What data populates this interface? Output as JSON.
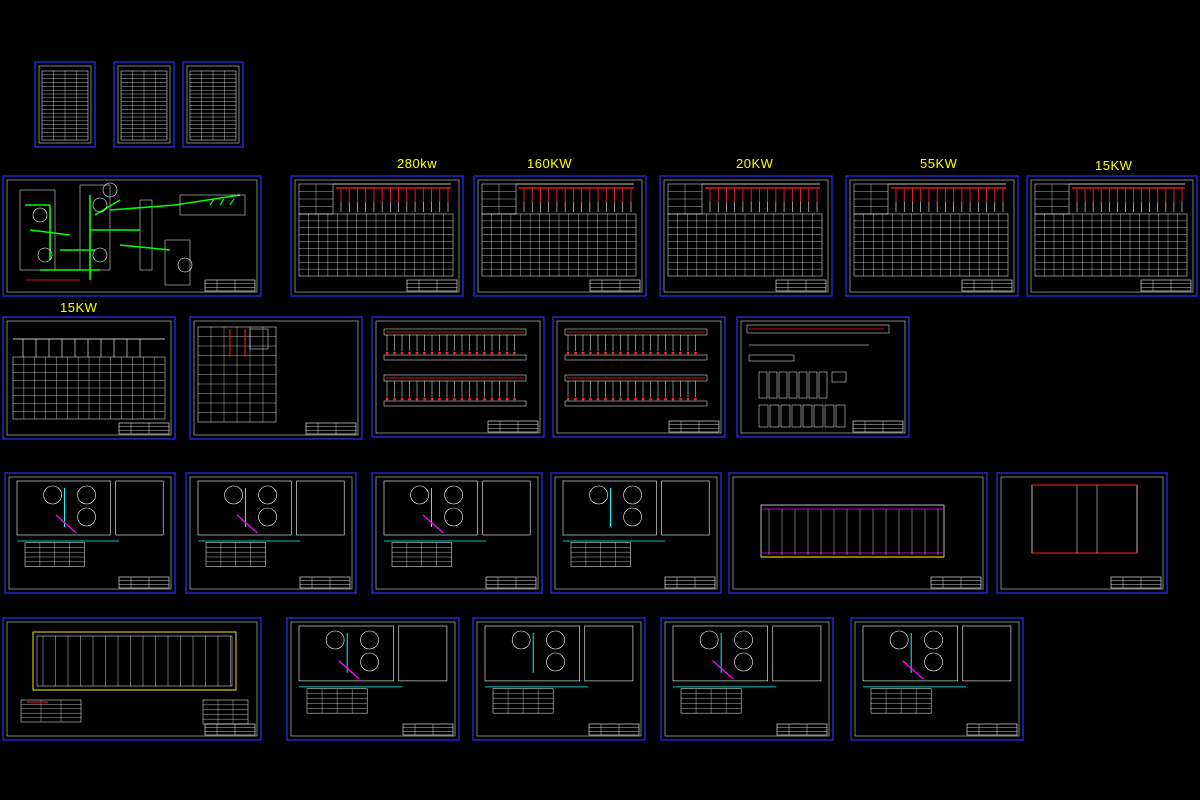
{
  "colors": {
    "background": "#000000",
    "sheet_border": "#3030ff",
    "label": "#ffff00",
    "white_line": "#ffffff",
    "red": "#ff2020",
    "green": "#00ff00",
    "cyan": "#00ffff",
    "magenta": "#ff00ff",
    "yellow": "#ffff00"
  },
  "power_labels": {
    "p280": "280kw",
    "p160": "160KW",
    "p20": "20KW",
    "p55": "55KW",
    "p15a": "15KW",
    "p15b": "15KW"
  }
}
